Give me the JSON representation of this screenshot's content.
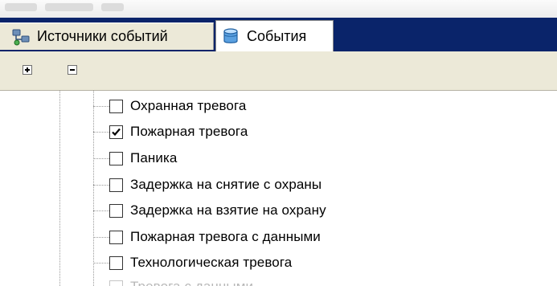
{
  "tabs": [
    {
      "label": "Источники событий",
      "icon": "event-sources-icon",
      "active": false
    },
    {
      "label": "События",
      "icon": "events-cylinder-icon",
      "active": true
    }
  ],
  "toolbar": {
    "expand_icon": "plus-square-icon",
    "collapse_icon": "minus-square-icon"
  },
  "tree": {
    "items": [
      {
        "label": "Охранная тревога",
        "checked": false
      },
      {
        "label": "Пожарная тревога",
        "checked": true
      },
      {
        "label": "Паника",
        "checked": false
      },
      {
        "label": "Задержка на снятие с охраны",
        "checked": false
      },
      {
        "label": "Задержка на взятие на охрану",
        "checked": false
      },
      {
        "label": "Пожарная тревога с данными",
        "checked": false
      },
      {
        "label": "Технологическая тревога",
        "checked": false
      },
      {
        "label": "Тревога с данными",
        "checked": false
      }
    ]
  },
  "colors": {
    "tab_bar": "#0a246a",
    "toolbar": "#ece9d8",
    "tree_background": "#ffffff"
  }
}
